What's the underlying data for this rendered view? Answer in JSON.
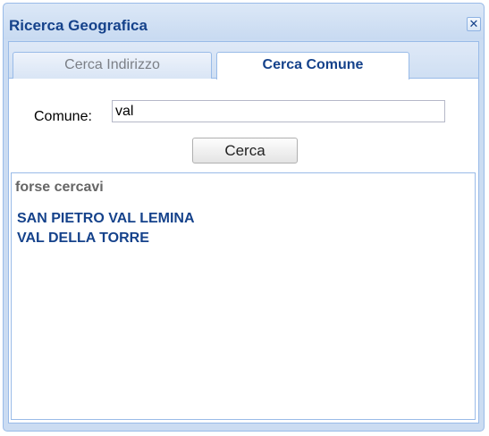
{
  "window": {
    "title": "Ricerca Geografica",
    "close_glyph": "✕"
  },
  "tabs": [
    {
      "label": "Cerca Indirizzo",
      "active": false
    },
    {
      "label": "Cerca Comune",
      "active": true
    }
  ],
  "form": {
    "comune_label": "Comune:",
    "comune_value": "val",
    "search_button": "Cerca"
  },
  "results": {
    "heading": "forse cercavi",
    "items": [
      "SAN PIETRO VAL LEMINA",
      "VAL DELLA TORRE"
    ]
  },
  "colors": {
    "title_text": "#15428b",
    "border": "#99bbe8",
    "window_bg": "#cbdcf2",
    "link_text": "#15428b"
  },
  "icons": {
    "close": "close-icon"
  }
}
